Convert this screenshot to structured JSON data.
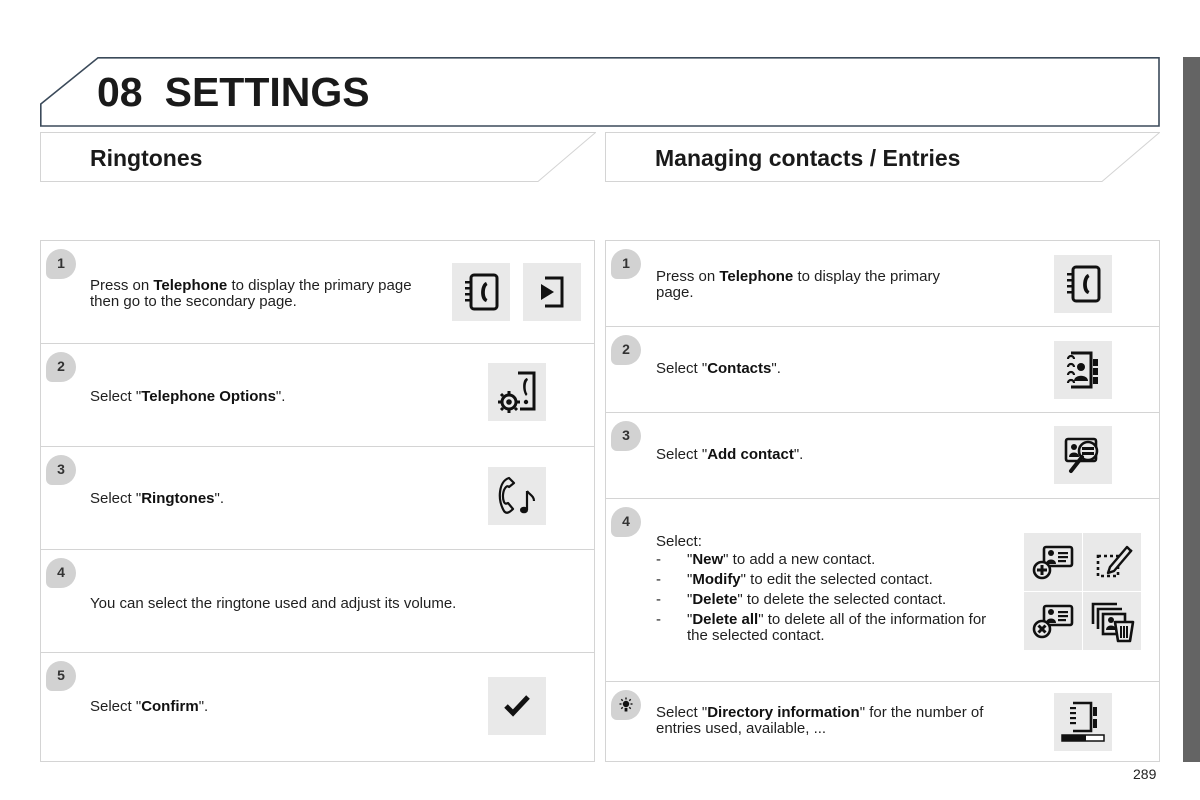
{
  "chapter": {
    "number": "08",
    "title": "SETTINGS"
  },
  "sections": {
    "left": {
      "title": "Ringtones",
      "steps": [
        {
          "badge": "1",
          "text_parts": [
            "Press on ",
            "Telephone",
            " to display the primary page then go to the secondary page."
          ],
          "icons": [
            "telephone-icon",
            "secondary-page-icon"
          ]
        },
        {
          "badge": "2",
          "text_parts": [
            "Select \"",
            "Telephone Options",
            "\"."
          ],
          "icons": [
            "telephone-options-icon"
          ]
        },
        {
          "badge": "3",
          "text_parts": [
            "Select \"",
            "Ringtones",
            "\"."
          ],
          "icons": [
            "ringtones-icon"
          ]
        },
        {
          "badge": "4",
          "text": "You can select the ringtone used and adjust its volume.",
          "icons": []
        },
        {
          "badge": "5",
          "text_parts": [
            "Select \"",
            "Confirm",
            "\"."
          ],
          "icons": [
            "confirm-check-icon"
          ]
        }
      ]
    },
    "right": {
      "title": "Managing contacts / Entries",
      "steps": [
        {
          "badge": "1",
          "text_parts": [
            "Press on ",
            "Telephone",
            " to display the primary page."
          ],
          "icons": [
            "telephone-icon"
          ]
        },
        {
          "badge": "2",
          "text_parts": [
            "Select \"",
            "Contacts",
            "\"."
          ],
          "icons": [
            "contacts-icon"
          ]
        },
        {
          "badge": "3",
          "text_parts": [
            "Select \"",
            "Add contact",
            "\"."
          ],
          "icons": [
            "add-contact-search-icon"
          ]
        },
        {
          "badge": "4",
          "intro": "Select:",
          "bullets": [
            {
              "dash": "-",
              "bold": "New",
              "rest": " to add a new contact."
            },
            {
              "dash": "-",
              "bold": "Modify",
              "rest": " to edit the selected contact."
            },
            {
              "dash": "-",
              "bold": "Delete",
              "rest": " to delete the selected contact."
            },
            {
              "dash": "-",
              "bold": "Delete all",
              "rest": " to delete all of the information for the selected contact."
            }
          ],
          "icons": [
            "new-contact-icon",
            "modify-contact-icon",
            "delete-contact-icon",
            "delete-all-icon"
          ]
        },
        {
          "badge": "tip",
          "text_parts": [
            "Select \"",
            "Directory information",
            "\" for the number of entries used, available, ..."
          ],
          "icons": [
            "directory-information-icon"
          ]
        }
      ]
    }
  },
  "page_number": "289",
  "colors": {
    "header_border": "#3b4a5a",
    "badge_bg": "#d2d2d2",
    "icon_bg": "#e9e9e9",
    "side_tab": "#646464",
    "panel_border": "#d4d4d4"
  }
}
